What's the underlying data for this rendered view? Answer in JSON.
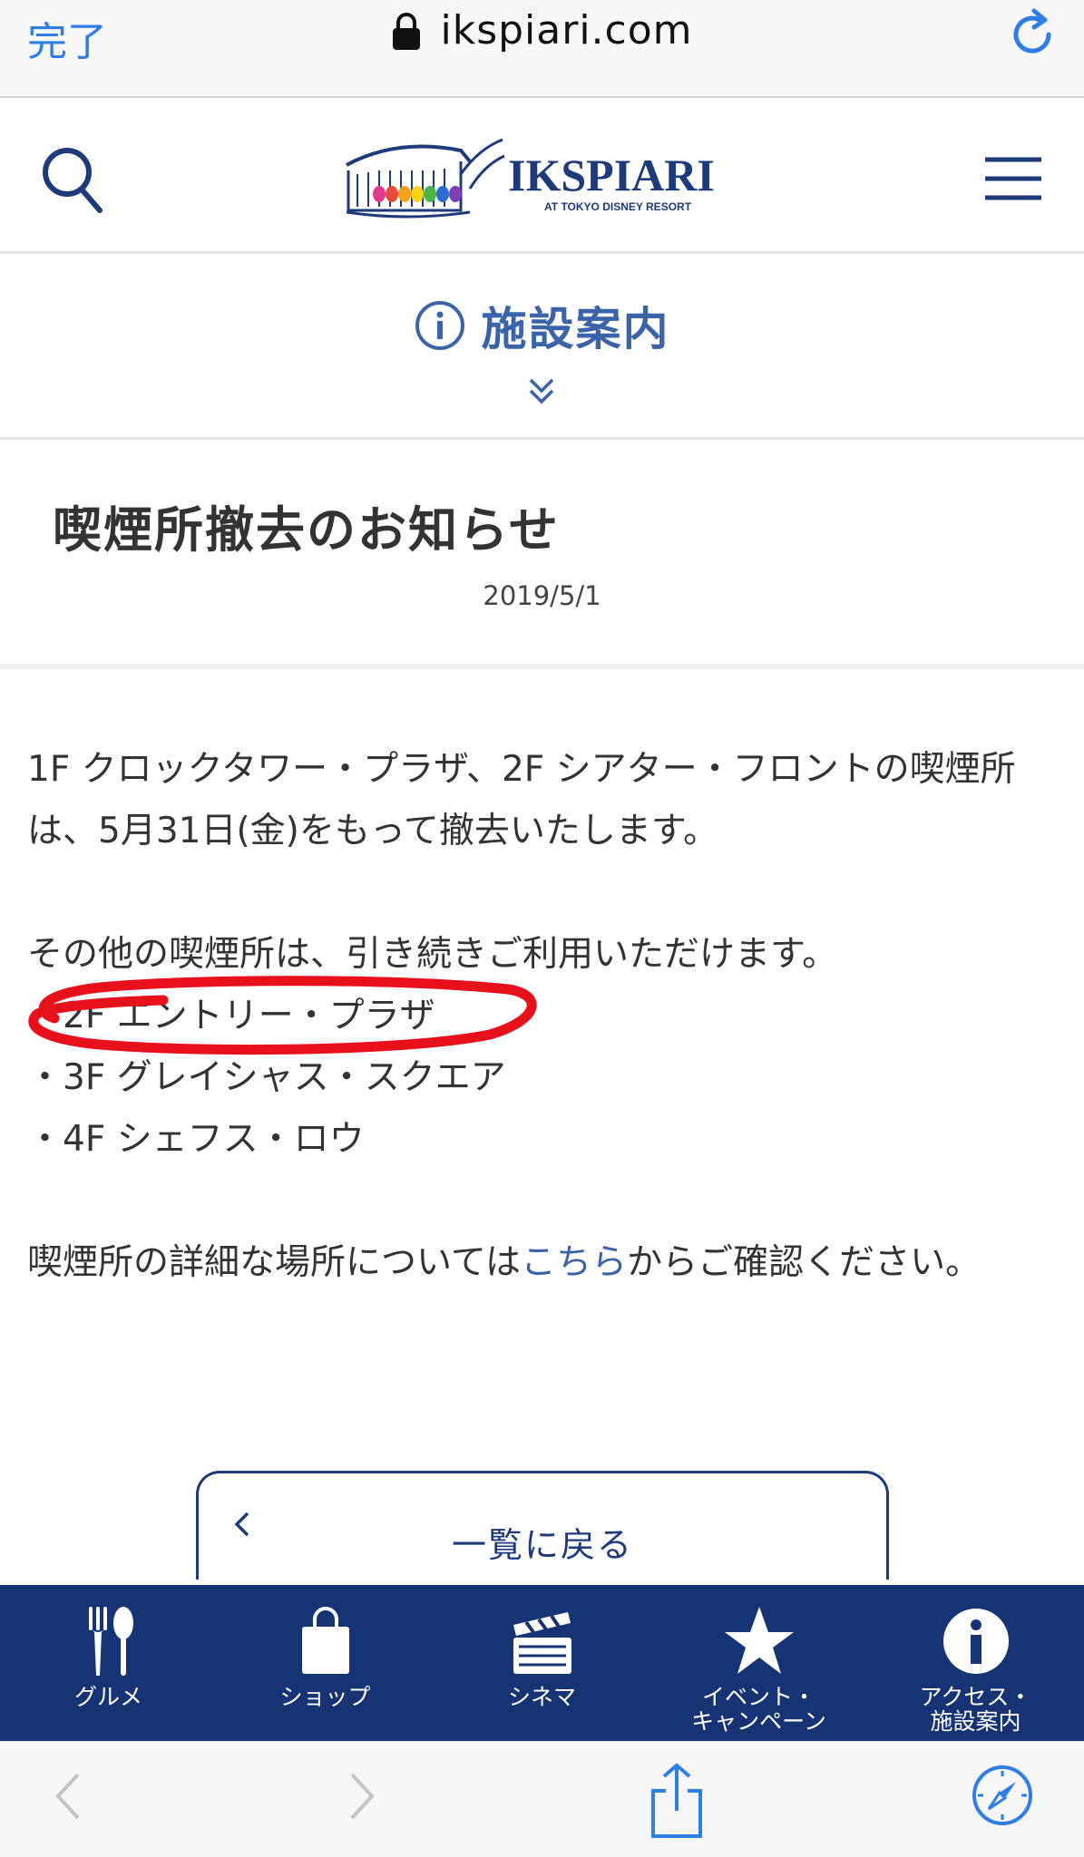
{
  "browser": {
    "done_label": "完了",
    "url": "ikspiari.com"
  },
  "header": {
    "logo_text": "IKSPIARI",
    "logo_subtext": "AT TOKYO DISNEY RESORT"
  },
  "facility": {
    "title": "施設案内"
  },
  "article": {
    "title": "喫煙所撤去のお知らせ",
    "date": "2019/5/1",
    "para1": "1F クロックタワー・プラザ、2F シアター・フロントの喫煙所は、5月31日(金)をもって撤去いたします。",
    "para2_intro": "その他の喫煙所は、引き続きご利用いただけます。",
    "locations": [
      "・2F エントリー・プラザ",
      "・3F グレイシャス・スクエア",
      "・4F シェフス・ロウ"
    ],
    "para3_before": "喫煙所の詳細な場所については",
    "para3_link": "こちら",
    "para3_after": "からご確認ください。"
  },
  "back_button": {
    "label": "一覧に戻る"
  },
  "bottom_nav": {
    "items": [
      {
        "label": "グルメ",
        "icon": "gourmet-icon"
      },
      {
        "label": "ショップ",
        "icon": "shop-bag-icon"
      },
      {
        "label": "シネマ",
        "icon": "cinema-clapper-icon"
      },
      {
        "label": "イベント・\nキャンペーン",
        "icon": "event-star-icon"
      },
      {
        "label": "アクセス・\n施設案内",
        "icon": "info-icon"
      }
    ]
  },
  "colors": {
    "brand_navy": "#163474",
    "link_blue": "#3a63a8",
    "safari_blue": "#2f7ee6",
    "highlight_red": "#e8101a"
  }
}
